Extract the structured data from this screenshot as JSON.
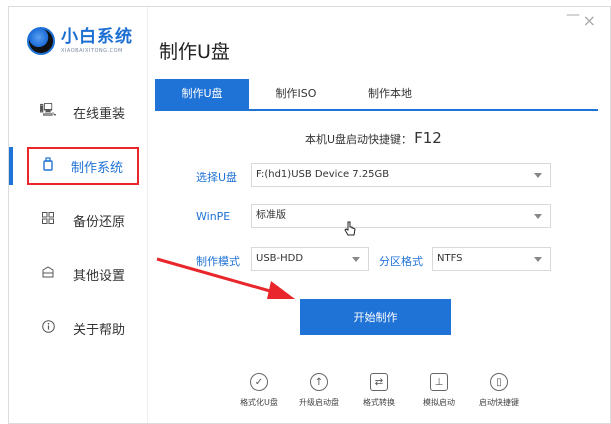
{
  "app": {
    "brand": "小白系统",
    "brand_sub": "XIAOBAIXITONG.COM"
  },
  "window": {
    "close_glyph": "×",
    "minimize_glyph": "—"
  },
  "sidebar": {
    "items": [
      {
        "label": "在线重装",
        "icon": "monitor-icon"
      },
      {
        "label": "制作系统",
        "icon": "usb-icon"
      },
      {
        "label": "备份还原",
        "icon": "grid-icon"
      },
      {
        "label": "其他设置",
        "icon": "box-icon"
      },
      {
        "label": "关于帮助",
        "icon": "info-icon"
      }
    ],
    "active_index": 1
  },
  "main": {
    "title": "制作U盘",
    "tabs": [
      {
        "label": "制作U盘"
      },
      {
        "label": "制作ISO"
      },
      {
        "label": "制作本地"
      }
    ],
    "hotkey_text": "本机U盘启动快捷键：",
    "hotkey_value": "F12",
    "fields": {
      "select_udisk_label": "选择U盘",
      "select_udisk_value": "F:(hd1)USB Device 7.25GB",
      "winpe_label": "WinPE",
      "winpe_value": "标准版",
      "mode_label": "制作模式",
      "mode_value": "USB-HDD",
      "partition_label": "分区格式",
      "partition_value": "NTFS"
    },
    "start_button": "开始制作"
  },
  "tools": [
    {
      "label": "格式化U盘",
      "icon": "check-circle-icon"
    },
    {
      "label": "升级启动盘",
      "icon": "upload-circle-icon"
    },
    {
      "label": "格式转换",
      "icon": "convert-icon"
    },
    {
      "label": "模拟启动",
      "icon": "tree-icon"
    },
    {
      "label": "启动快捷键",
      "icon": "mouse-icon"
    }
  ],
  "colors": {
    "accent": "#1f72d6",
    "highlight": "#e8262b"
  }
}
